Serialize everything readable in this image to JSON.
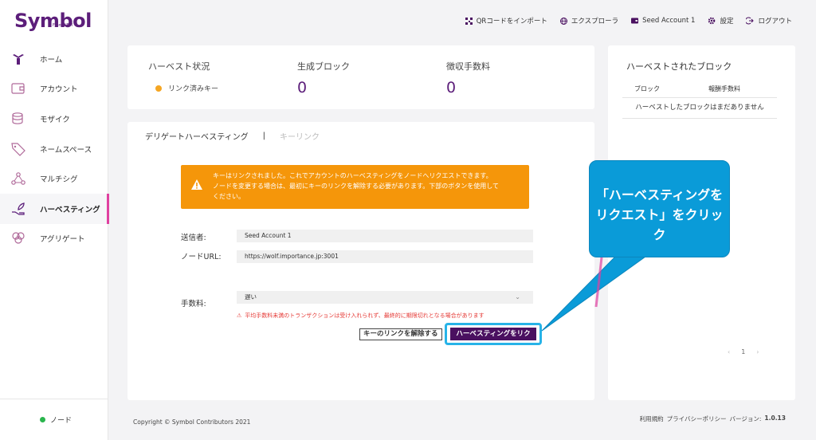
{
  "app": {
    "logo": "Symbol",
    "logo_sub": "From NEM"
  },
  "sidebar": {
    "items": [
      {
        "label": "ホーム",
        "icon": "home-icon"
      },
      {
        "label": "アカウント",
        "icon": "account-icon"
      },
      {
        "label": "モザイク",
        "icon": "mosaic-icon"
      },
      {
        "label": "ネームスペース",
        "icon": "namespace-icon"
      },
      {
        "label": "マルチシグ",
        "icon": "multisig-icon"
      },
      {
        "label": "ハーベスティング",
        "icon": "harvesting-icon",
        "active": true
      },
      {
        "label": "アグリゲート",
        "icon": "aggregate-icon"
      }
    ],
    "node_label": "ノード"
  },
  "header": {
    "qr_import": "QRコードをインポート",
    "explorer": "エクスプローラ",
    "account": "Seed Account 1",
    "settings": "設定",
    "logout": "ログアウト"
  },
  "status": {
    "harvest_status_label": "ハーベスト状況",
    "linked_key": "リンク済みキー",
    "blocks_label": "生成ブロック",
    "blocks_value": "0",
    "fees_label": "徴収手数料",
    "fees_value": "0"
  },
  "harvested": {
    "title": "ハーベストされたブロック",
    "col_block": "ブロック",
    "col_reward": "報酬手数料",
    "empty": "ハーベストしたブロックはまだありません",
    "page": "1"
  },
  "tabs": {
    "delegated": "デリゲートハーベスティング",
    "separator": "|",
    "key_link": "キーリンク"
  },
  "notice": {
    "line1": "キーはリンクされました。これでアカウントのハーベスティングをノードへリクエストできます。",
    "line2": "ノードを変更する場合は、最初にキーのリンクを解除する必要があります。下部のボタンを使用して",
    "line3": "ください。"
  },
  "form": {
    "sender_label": "送信者:",
    "sender_value": "Seed Account 1",
    "node_label": "ノードURL:",
    "node_value": "https://wolf.importance.jp:3001",
    "fee_label": "手数料:",
    "fee_value": "遅い",
    "fee_warning": "平均手数料未満のトランザクションは受け入れられず、最終的に期限切れとなる場合があります"
  },
  "buttons": {
    "unlink": "キーのリンクを解除する",
    "request": "ハーベスティングをリク"
  },
  "callout": {
    "line1": "「ハーベスティングを",
    "line2": "リクエスト」をクリック"
  },
  "footer": {
    "copyright": "Copyright © Symbol Contributors 2021",
    "terms": "利用規約",
    "privacy": "プライバシーポリシー",
    "version_label": "バージョン:",
    "version": "1.0.13"
  },
  "colors": {
    "brand": "#5c1e7a",
    "accent": "#e040a0",
    "callout": "#0a9bd8",
    "notice": "#f5960a"
  }
}
